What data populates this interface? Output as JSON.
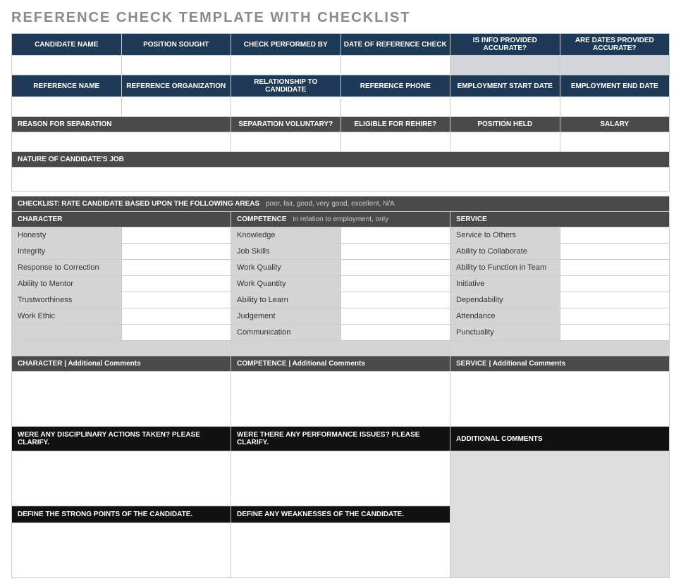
{
  "title": "REFERENCE CHECK TEMPLATE WITH CHECKLIST",
  "row1_headers": [
    "CANDIDATE NAME",
    "POSITION SOUGHT",
    "CHECK PERFORMED BY",
    "DATE OF REFERENCE CHECK",
    "IS INFO PROVIDED ACCURATE?",
    "ARE DATES PROVIDED ACCURATE?"
  ],
  "row2_headers": [
    "REFERENCE NAME",
    "REFERENCE ORGANIZATION",
    "RELATIONSHIP TO CANDIDATE",
    "REFERENCE PHONE",
    "EMPLOYMENT START DATE",
    "EMPLOYMENT END DATE"
  ],
  "row3_header_first": "REASON FOR SEPARATION",
  "row3_headers_rest": [
    "SEPARATION VOLUNTARY?",
    "ELIGIBLE FOR REHIRE?",
    "POSITION HELD",
    "SALARY"
  ],
  "nature_header": "NATURE OF CANDIDATE'S JOB",
  "checklist_title": "CHECKLIST: RATE CANDIDATE BASED UPON THE FOLLOWING AREAS",
  "checklist_sub": "poor, fair, good, very good, excellent, N/A",
  "col_headers": {
    "character": "CHARACTER",
    "competence": "COMPETENCE",
    "competence_sub": "in relation to employment, only",
    "service": "SERVICE"
  },
  "character_items": [
    "Honesty",
    "Integrity",
    "Response to Correction",
    "Ability to Mentor",
    "Trustworthiness",
    "Work Ethic"
  ],
  "competence_items": [
    "Knowledge",
    "Job Skills",
    "Work Quality",
    "Work Quantity",
    "Ability to Learn",
    "Judgement",
    "Communication"
  ],
  "service_items": [
    "Service to Others",
    "Ability to Collaborate",
    "Ability to Function in Team",
    "Initiative",
    "Dependability",
    "Attendance",
    "Punctuality"
  ],
  "comments_headers": {
    "character": "CHARACTER  |  Additional Comments",
    "competence": "COMPETENCE  |  Additional Comments",
    "service": "SERVICE  |  Additional Comments"
  },
  "q_headers": {
    "disciplinary": "WERE ANY DISCIPLINARY ACTIONS TAKEN? PLEASE CLARIFY.",
    "performance": "WERE THERE ANY PERFORMANCE ISSUES? PLEASE CLARIFY.",
    "additional": "ADDITIONAL COMMENTS",
    "strong": "DEFINE THE STRONG POINTS OF THE CANDIDATE.",
    "weak": "DEFINE ANY WEAKNESSES OF THE CANDIDATE."
  }
}
